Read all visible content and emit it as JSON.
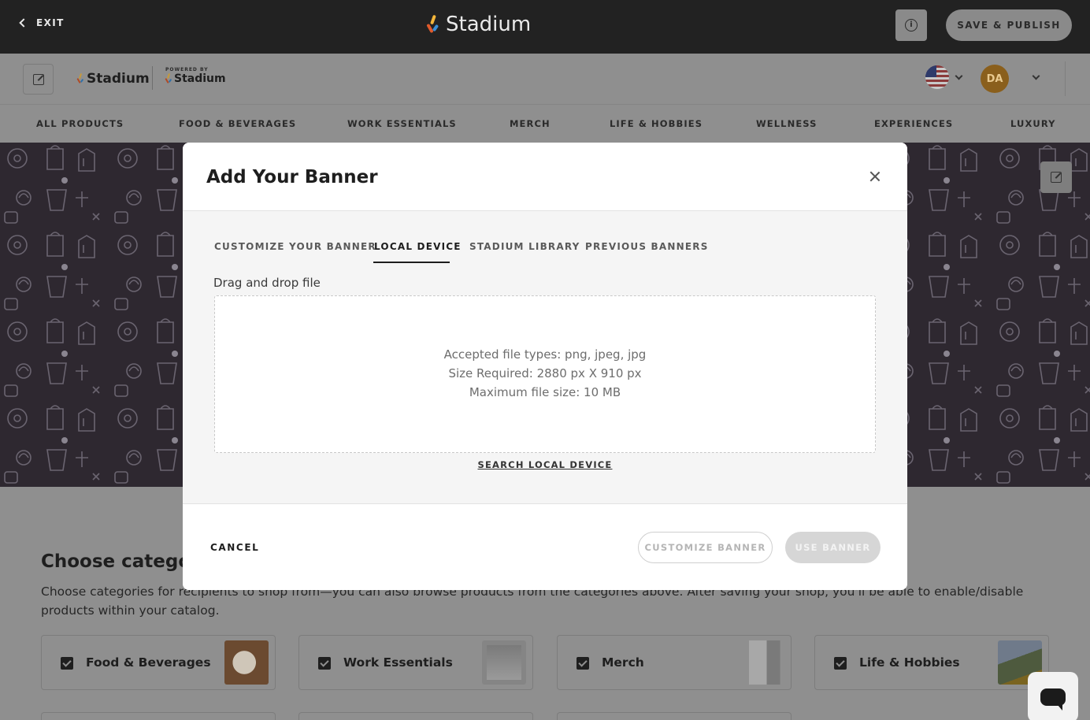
{
  "topbar": {
    "exit_label": "EXIT",
    "brand": "Stadium",
    "publish_label": "SAVE & PUBLISH"
  },
  "shop_header": {
    "logo_text": "Stadium",
    "powered_by": "POWERED BY",
    "powered_logo": "Stadium",
    "avatar_initials": "DA",
    "language_flag": "us-flag-icon"
  },
  "category_nav": {
    "items": [
      "ALL PRODUCTS",
      "FOOD & BEVERAGES",
      "WORK ESSENTIALS",
      "MERCH",
      "LIFE & HOBBIES",
      "WELLNESS",
      "EXPERIENCES",
      "LUXURY"
    ]
  },
  "page": {
    "choose_title": "Choose categori",
    "choose_desc": "Choose categories for recipients to shop from—you can also browse products from the categories above. After saving your shop, you'll be able to enable/disable products within your catalog.",
    "categories": [
      {
        "label": "Food & Beverages",
        "checked": true
      },
      {
        "label": "Work Essentials",
        "checked": true
      },
      {
        "label": "Merch",
        "checked": true
      },
      {
        "label": "Life & Hobbies",
        "checked": true
      }
    ]
  },
  "modal": {
    "title": "Add Your Banner",
    "tabs": [
      {
        "label": "CUSTOMIZE YOUR BANNER",
        "active": false
      },
      {
        "label": "LOCAL DEVICE",
        "active": true
      },
      {
        "label": "STADIUM LIBRARY",
        "active": false
      },
      {
        "label": "PREVIOUS BANNERS",
        "active": false
      }
    ],
    "dropzone_label": "Drag and drop file",
    "dropzone_lines": [
      "Accepted file types: png, jpeg, jpg",
      "Size Required: 2880 px X 910 px",
      "Maximum file size: 10 MB"
    ],
    "search_link": "SEARCH LOCAL DEVICE",
    "cancel_label": "CANCEL",
    "customize_label": "CUSTOMIZE BANNER",
    "use_label": "USE BANNER"
  },
  "colors": {
    "topbar_bg": "#222222",
    "overlay_gray": "#8f8f8f",
    "hero_bg": "#2e2830",
    "modal_bg": "#ffffff"
  }
}
